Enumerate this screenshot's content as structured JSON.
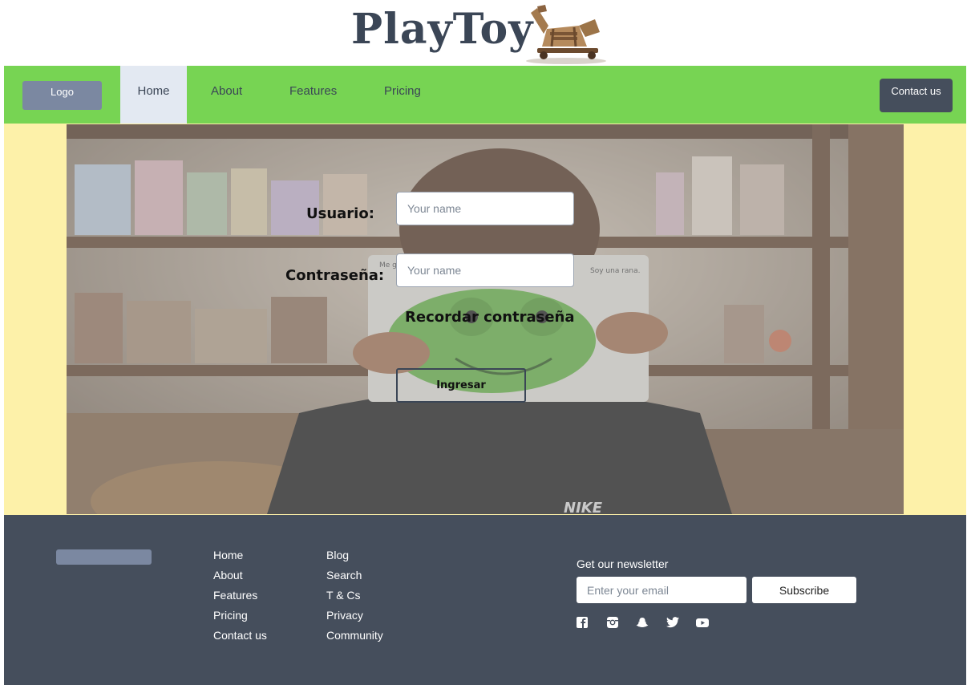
{
  "brand": {
    "title": "PlayToy"
  },
  "nav": {
    "logo": "Logo",
    "links": [
      "Home",
      "About",
      "Features",
      "Pricing"
    ],
    "active": "Home",
    "contact": "Contact us"
  },
  "login": {
    "user_label": "Usuario:",
    "user_placeholder": "Your name",
    "password_label": "Contraseña:",
    "password_placeholder": "Your name",
    "remember_label": "Recordar contraseña",
    "submit": "Ingresar",
    "image_text": {
      "left_card": "Me g",
      "right_card": "Soy una rana.",
      "shirt": "NIKE"
    }
  },
  "footer": {
    "col1": [
      "Home",
      "About",
      "Features",
      "Pricing",
      "Contact us"
    ],
    "col2": [
      "Blog",
      "Search",
      "T & Cs",
      "Privacy",
      "Community"
    ],
    "newsletter_title": "Get our newsletter",
    "email_placeholder": "Enter your email",
    "subscribe": "Subscribe",
    "social_icons": [
      "facebook-icon",
      "instagram-icon",
      "snapchat-icon",
      "twitter-icon",
      "youtube-icon"
    ]
  },
  "colors": {
    "nav_green": "#77d453",
    "hero_yellow": "#fdf1a9",
    "footer_slate": "#454e5c",
    "logo_gray": "#7b88a1",
    "title_slate": "#3b4656",
    "active_tab": "#e3e9f2"
  }
}
